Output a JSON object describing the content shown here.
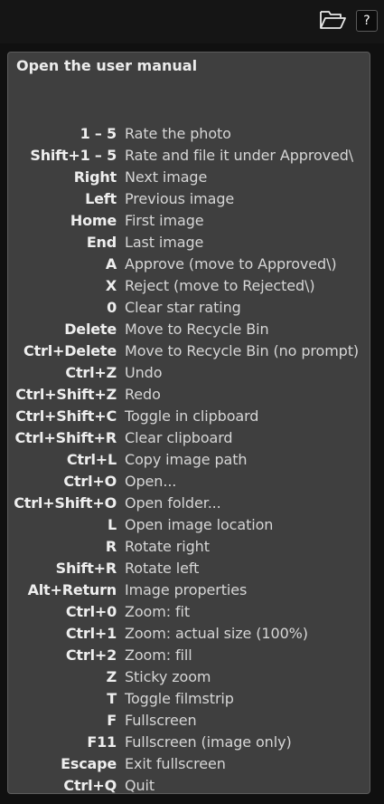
{
  "topbar": {
    "folder_icon": "folder-open-icon",
    "help_label": "?"
  },
  "panel": {
    "title": "Open the user manual",
    "shortcuts": [
      {
        "key": "1 – 5",
        "desc": "Rate the photo"
      },
      {
        "key": "Shift+1 – 5",
        "desc": "Rate and file it under Approved\\"
      },
      {
        "key": "Right",
        "desc": "Next image"
      },
      {
        "key": "Left",
        "desc": "Previous image"
      },
      {
        "key": "Home",
        "desc": "First image"
      },
      {
        "key": "End",
        "desc": "Last image"
      },
      {
        "key": "A",
        "desc": "Approve (move to Approved\\)"
      },
      {
        "key": "X",
        "desc": "Reject (move to Rejected\\)"
      },
      {
        "key": "0",
        "desc": "Clear star rating"
      },
      {
        "key": "Delete",
        "desc": "Move to Recycle Bin"
      },
      {
        "key": "Ctrl+Delete",
        "desc": "Move to Recycle Bin (no prompt)"
      },
      {
        "key": "Ctrl+Z",
        "desc": "Undo"
      },
      {
        "key": "Ctrl+Shift+Z",
        "desc": "Redo"
      },
      {
        "key": "Ctrl+Shift+C",
        "desc": "Toggle in clipboard"
      },
      {
        "key": "Ctrl+Shift+R",
        "desc": "Clear clipboard"
      },
      {
        "key": "Ctrl+L",
        "desc": "Copy image path"
      },
      {
        "key": "Ctrl+O",
        "desc": "Open..."
      },
      {
        "key": "Ctrl+Shift+O",
        "desc": "Open folder..."
      },
      {
        "key": "L",
        "desc": "Open image location"
      },
      {
        "key": "R",
        "desc": "Rotate right"
      },
      {
        "key": "Shift+R",
        "desc": "Rotate left"
      },
      {
        "key": "Alt+Return",
        "desc": "Image properties"
      },
      {
        "key": "Ctrl+0",
        "desc": "Zoom: fit"
      },
      {
        "key": "Ctrl+1",
        "desc": "Zoom: actual size (100%)"
      },
      {
        "key": "Ctrl+2",
        "desc": "Zoom: fill"
      },
      {
        "key": "Z",
        "desc": "Sticky zoom"
      },
      {
        "key": "T",
        "desc": "Toggle filmstrip"
      },
      {
        "key": "F",
        "desc": "Fullscreen"
      },
      {
        "key": "F11",
        "desc": "Fullscreen (image only)"
      },
      {
        "key": "Escape",
        "desc": "Exit fullscreen"
      },
      {
        "key": "Ctrl+Q",
        "desc": "Quit"
      }
    ]
  },
  "colors": {
    "background": "#101010",
    "panel": "#3f3f3f",
    "panel_border": "#5c5c5c",
    "text": "#e6e6e6"
  }
}
